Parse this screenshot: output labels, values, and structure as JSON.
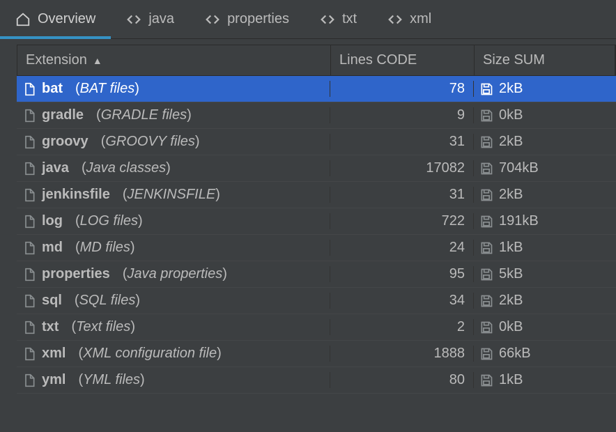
{
  "tabs": [
    {
      "label": "Overview",
      "icon": "home",
      "active": true
    },
    {
      "label": "java",
      "icon": "code",
      "active": false
    },
    {
      "label": "properties",
      "icon": "code",
      "active": false
    },
    {
      "label": "txt",
      "icon": "code",
      "active": false
    },
    {
      "label": "xml",
      "icon": "code",
      "active": false
    }
  ],
  "columns": {
    "extension": "Extension",
    "lines": "Lines CODE",
    "size": "Size SUM"
  },
  "sort": {
    "column": "extension",
    "dir": "asc"
  },
  "rows": [
    {
      "ext": "bat",
      "desc": "BAT files",
      "lines": "78",
      "size": "2kB",
      "selected": true
    },
    {
      "ext": "gradle",
      "desc": "GRADLE files",
      "lines": "9",
      "size": "0kB",
      "selected": false
    },
    {
      "ext": "groovy",
      "desc": "GROOVY files",
      "lines": "31",
      "size": "2kB",
      "selected": false
    },
    {
      "ext": "java",
      "desc": "Java classes",
      "lines": "17082",
      "size": "704kB",
      "selected": false
    },
    {
      "ext": "jenkinsfile",
      "desc": "JENKINSFILE",
      "lines": "31",
      "size": "2kB",
      "selected": false
    },
    {
      "ext": "log",
      "desc": "LOG files",
      "lines": "722",
      "size": "191kB",
      "selected": false
    },
    {
      "ext": "md",
      "desc": "MD files",
      "lines": "24",
      "size": "1kB",
      "selected": false
    },
    {
      "ext": "properties",
      "desc": "Java properties",
      "lines": "95",
      "size": "5kB",
      "selected": false
    },
    {
      "ext": "sql",
      "desc": "SQL files",
      "lines": "34",
      "size": "2kB",
      "selected": false
    },
    {
      "ext": "txt",
      "desc": "Text files",
      "lines": "2",
      "size": "0kB",
      "selected": false
    },
    {
      "ext": "xml",
      "desc": "XML configuration file",
      "lines": "1888",
      "size": "66kB",
      "selected": false
    },
    {
      "ext": "yml",
      "desc": "YML files",
      "lines": "80",
      "size": "1kB",
      "selected": false
    }
  ]
}
